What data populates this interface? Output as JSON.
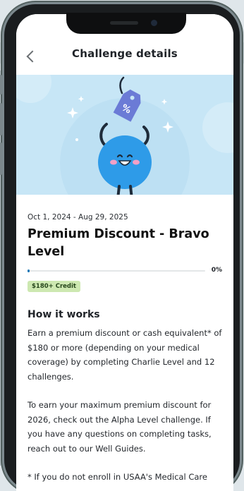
{
  "header": {
    "title": "Challenge details"
  },
  "hero": {
    "tag_symbol": "%",
    "background_color": "#c7e6f6",
    "character_color": "#2e9be8"
  },
  "challenge": {
    "dates": "Oct 1, 2024 - Aug 29, 2025",
    "name": "Premium Discount - Bravo Level",
    "progress": 0,
    "progress_label": "0%",
    "badge": "$180+ Credit"
  },
  "how_it_works": {
    "title": "How it works",
    "paragraph1": "Earn a premium discount or cash equivalent* of $180 or more (depending on your medical coverage) by completing Charlie Level and 12 challenges.",
    "paragraph2": "To earn your maximum premium discount for 2026, check out the Alpha Level challenge. If you have any questions on completing tasks, reach out to our Well Guides.",
    "footnote": "* If you do not enroll in USAA's Medical Care"
  }
}
